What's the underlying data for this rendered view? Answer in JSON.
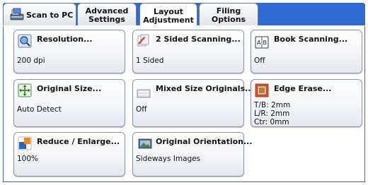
{
  "tabs": [
    {
      "label": "Scan to PC"
    },
    {
      "label": "Advanced\nSettings"
    },
    {
      "label": "Layout\nAdjustment"
    },
    {
      "label": "Filing Options"
    }
  ],
  "buttons": {
    "resolution": {
      "title": "Resolution...",
      "value": "200 dpi",
      "icon": "magnifier-icon"
    },
    "two_sided": {
      "title": "2 Sided Scanning...",
      "value": "1 Sided",
      "icon": "two-sided-icon"
    },
    "book": {
      "title": "Book Scanning...",
      "value": "Off",
      "icon": "book-icon"
    },
    "original_size": {
      "title": "Original Size...",
      "value": "Auto Detect",
      "icon": "resize-arrows-icon"
    },
    "mixed_size": {
      "title": "Mixed Size Originals...",
      "value": "Off",
      "icon": "mixed-size-icon"
    },
    "edge_erase": {
      "title": "Edge Erase...",
      "value": "T/B: 2mm\nL/R: 2mm\nCtr: 0mm",
      "icon": "edge-erase-icon"
    },
    "reduce": {
      "title": "Reduce / Enlarge...",
      "value": "100%",
      "icon": "reduce-enlarge-icon"
    },
    "orientation": {
      "title": "Original Orientation...",
      "value": "Sideways Images",
      "icon": "orientation-icon"
    }
  },
  "colors": {
    "tabbar": "#2e6bd2",
    "panel_border": "#3d66c4"
  }
}
